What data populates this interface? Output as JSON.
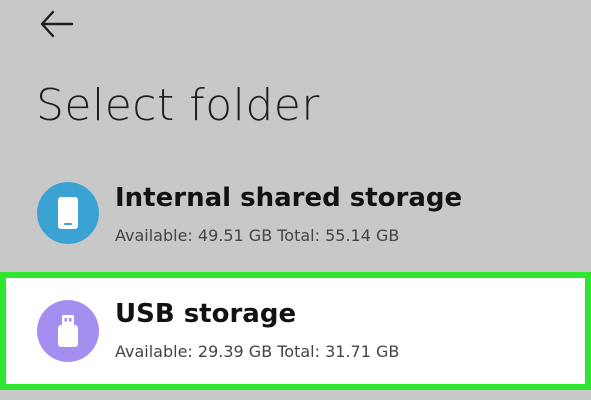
{
  "header": {
    "back_icon": "arrow-left-icon",
    "title": "Select folder"
  },
  "colors": {
    "background": "#c8c8c8",
    "internal_icon_bg": "#3aa3d3",
    "usb_icon_bg": "#a48ef0",
    "highlight_border": "#2ee62e"
  },
  "storage": [
    {
      "icon": "phone-icon",
      "name": "Internal shared storage",
      "details": "Available: 49.51 GB Total: 55.14 GB"
    },
    {
      "icon": "usb-drive-icon",
      "name": "USB storage",
      "details": "Available: 29.39 GB Total: 31.71 GB"
    }
  ]
}
